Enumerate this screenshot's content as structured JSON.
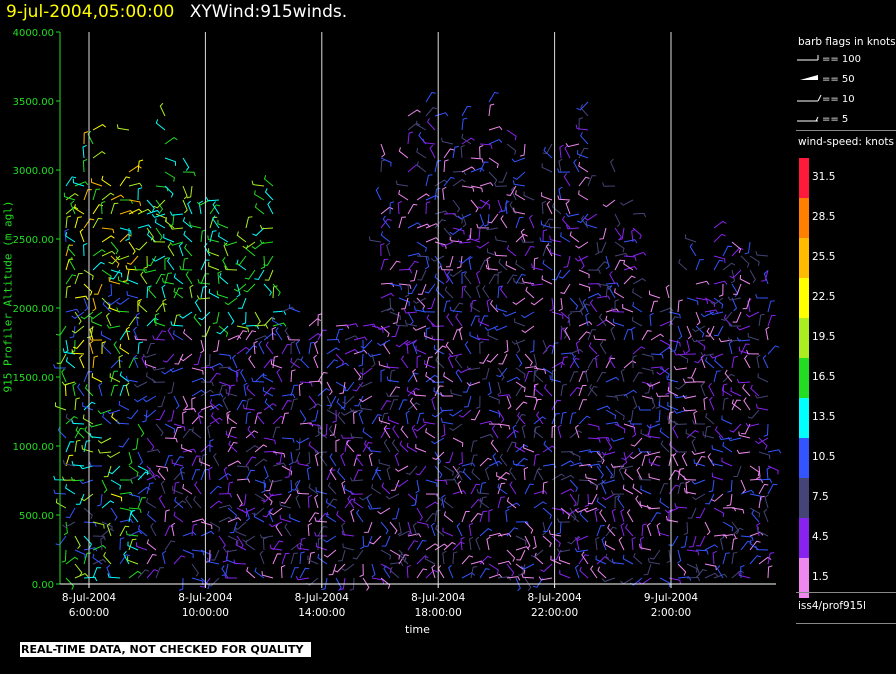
{
  "header": {
    "datetime": "9-jul-2004,05:00:00",
    "title": "XYWind:915winds."
  },
  "chart_data": {
    "type": "wind-barb time-height",
    "ylabel": "915 Profiler Altitude (m agl)",
    "xlabel": "time",
    "ylim": [
      0,
      4000
    ],
    "yticks": [
      "0.00",
      "500.00",
      "1000.00",
      "1500.00",
      "2000.00",
      "2500.00",
      "3000.00",
      "3500.00",
      "4000.00"
    ],
    "xticks": [
      {
        "date": "8-Jul-2004",
        "time": "6:00:00"
      },
      {
        "date": "8-Jul-2004",
        "time": "10:00:00"
      },
      {
        "date": "8-Jul-2004",
        "time": "14:00:00"
      },
      {
        "date": "8-Jul-2004",
        "time": "18:00:00"
      },
      {
        "date": "8-Jul-2004",
        "time": "22:00:00"
      },
      {
        "date": "9-Jul-2004",
        "time": "2:00:00"
      }
    ],
    "speed_units": "knots"
  },
  "legend": {
    "flags_title": "barb flags in knots",
    "flags": [
      "== 100",
      "== 50",
      "== 10",
      "== 5"
    ],
    "speed_title": "wind-speed: knots",
    "scale": [
      {
        "label": "31.5",
        "color": "#ff1a3c"
      },
      {
        "label": "28.5",
        "color": "#ff8000"
      },
      {
        "label": "25.5",
        "color": "#ffbb00"
      },
      {
        "label": "22.5",
        "color": "#ffff00"
      },
      {
        "label": "19.5",
        "color": "#aaee22"
      },
      {
        "label": "16.5",
        "color": "#22dd22"
      },
      {
        "label": "13.5",
        "color": "#00ffff"
      },
      {
        "label": "10.5",
        "color": "#3355ff"
      },
      {
        "label": "7.5",
        "color": "#444477"
      },
      {
        "label": "4.5",
        "color": "#8822ee"
      },
      {
        "label": "1.5",
        "color": "#ee88ee"
      }
    ],
    "station": "iss4/prof915l"
  },
  "footer": {
    "warning": "REAL-TIME DATA, NOT CHECKED FOR QUALITY"
  }
}
